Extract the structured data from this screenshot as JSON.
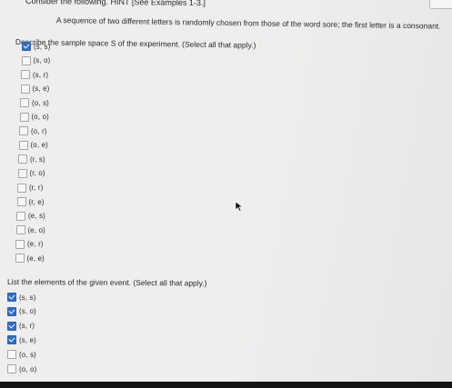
{
  "header": {
    "text": "Consider the following. HINT [See Examples 1-3.]"
  },
  "prompt": "A sequence of two different letters is randomly chosen from those of the word sore; the first letter is a consonant.",
  "instruction": "Describe the sample space S of the experiment. (Select all that apply.)",
  "sample_space": [
    {
      "label": "(s, s)",
      "checked": true
    },
    {
      "label": "(s, o)",
      "checked": false
    },
    {
      "label": "(s, r)",
      "checked": false
    },
    {
      "label": "(s, e)",
      "checked": false
    },
    {
      "label": "(o, s)",
      "checked": false
    },
    {
      "label": "(o, o)",
      "checked": false
    },
    {
      "label": "(o, r)",
      "checked": false
    },
    {
      "label": "(o, e)",
      "checked": false
    },
    {
      "label": "(r, s)",
      "checked": false
    },
    {
      "label": "(r, o)",
      "checked": false
    },
    {
      "label": "(r, r)",
      "checked": false
    },
    {
      "label": "(r, e)",
      "checked": false
    },
    {
      "label": "(e, s)",
      "checked": false
    },
    {
      "label": "(e, o)",
      "checked": false
    },
    {
      "label": "(e, r)",
      "checked": false
    },
    {
      "label": "(e, e)",
      "checked": false
    }
  ],
  "event_title": "List the elements of the given event. (Select all that apply.)",
  "event": [
    {
      "label": "(s, s)",
      "checked": true
    },
    {
      "label": "(s, o)",
      "checked": true
    },
    {
      "label": "(s, r)",
      "checked": true
    },
    {
      "label": "(s, e)",
      "checked": true
    },
    {
      "label": "(o, s)",
      "checked": false
    },
    {
      "label": "(o, o)",
      "checked": false
    }
  ],
  "colors": {
    "accent": "#2f6fc9",
    "background": "#ecebe9",
    "text": "#2a2a2e"
  }
}
